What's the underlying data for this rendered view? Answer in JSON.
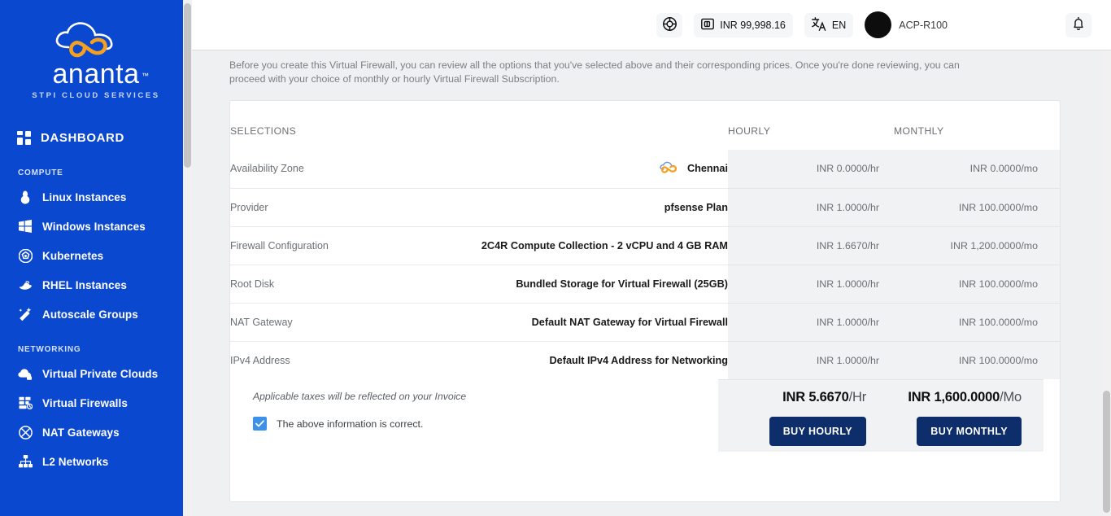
{
  "brand": {
    "name": "ananta",
    "tagline": "STPI CLOUD SERVICES",
    "tm": "™",
    "sidebar_color": "#0B48D0",
    "accent_orange": "#F5A01E"
  },
  "sidebar": {
    "dashboard": {
      "label": "DASHBOARD",
      "icon": "grid-icon"
    },
    "sections": [
      {
        "title": "COMPUTE",
        "items": [
          {
            "label": "Linux Instances",
            "icon": "linux-penguin-icon"
          },
          {
            "label": "Windows Instances",
            "icon": "windows-icon"
          },
          {
            "label": "Kubernetes",
            "icon": "kubernetes-helm-icon"
          },
          {
            "label": "RHEL Instances",
            "icon": "redhat-fedora-icon"
          },
          {
            "label": "Autoscale Groups",
            "icon": "magic-wand-icon"
          }
        ]
      },
      {
        "title": "NETWORKING",
        "items": [
          {
            "label": "Virtual Private Clouds",
            "icon": "cloud-lock-icon"
          },
          {
            "label": "Virtual Firewalls",
            "icon": "firewall-icon"
          },
          {
            "label": "NAT Gateways",
            "icon": "nat-gateway-icon"
          },
          {
            "label": "L2 Networks",
            "icon": "network-tree-icon"
          }
        ]
      }
    ]
  },
  "topbar": {
    "support_icon": "lifebuoy-icon",
    "wallet": {
      "icon": "wallet-icon",
      "label": "INR 99,998.16"
    },
    "language": {
      "icon": "translate-icon",
      "label": "EN"
    },
    "user": {
      "name": "ACP-R100",
      "avatar": "avatar"
    },
    "notifications_icon": "bell-icon"
  },
  "main": {
    "intro": "Before you create this Virtual Firewall, you can review all the options that you've selected above and their corresponding prices. Once you're done reviewing, you can proceed with your choice of monthly or hourly Virtual Firewall Subscription.",
    "table": {
      "headers": {
        "selections": "SELECTIONS",
        "hourly": "HOURLY",
        "monthly": "MONTHLY"
      },
      "rows": [
        {
          "label": "Availability Zone",
          "value": "Chennai",
          "icon": "ananta-zone-icon",
          "hourly": "INR 0.0000/hr",
          "monthly": "INR 0.0000/mo"
        },
        {
          "label": "Provider",
          "value": "pfsense Plan",
          "icon": "",
          "hourly": "INR 1.0000/hr",
          "monthly": "INR 100.0000/mo"
        },
        {
          "label": "Firewall Configuration",
          "value": "2C4R Compute Collection - 2 vCPU and 4 GB RAM",
          "icon": "",
          "hourly": "INR 1.6670/hr",
          "monthly": "INR 1,200.0000/mo"
        },
        {
          "label": "Root Disk",
          "value": "Bundled Storage for Virtual Firewall (25GB)",
          "icon": "",
          "hourly": "INR 1.0000/hr",
          "monthly": "INR 100.0000/mo"
        },
        {
          "label": "NAT Gateway",
          "value": "Default NAT Gateway for Virtual Firewall",
          "icon": "",
          "hourly": "INR 1.0000/hr",
          "monthly": "INR 100.0000/mo"
        },
        {
          "label": "IPv4 Address",
          "value": "Default IPv4 Address for Networking",
          "icon": "",
          "hourly": "INR 1.0000/hr",
          "monthly": "INR 100.0000/mo"
        }
      ]
    },
    "footer": {
      "taxes_note": "Applicable taxes will be reflected on your Invoice",
      "confirm_label": "The above information is correct.",
      "confirm_checked": true,
      "hourly_total_amount": "INR 5.6670",
      "hourly_total_unit": "/Hr",
      "monthly_total_amount": "INR 1,600.0000",
      "monthly_total_unit": "/Mo",
      "buy_hourly_label": "BUY HOURLY",
      "buy_monthly_label": "BUY MONTHLY",
      "button_color": "#0d2d6b"
    }
  }
}
